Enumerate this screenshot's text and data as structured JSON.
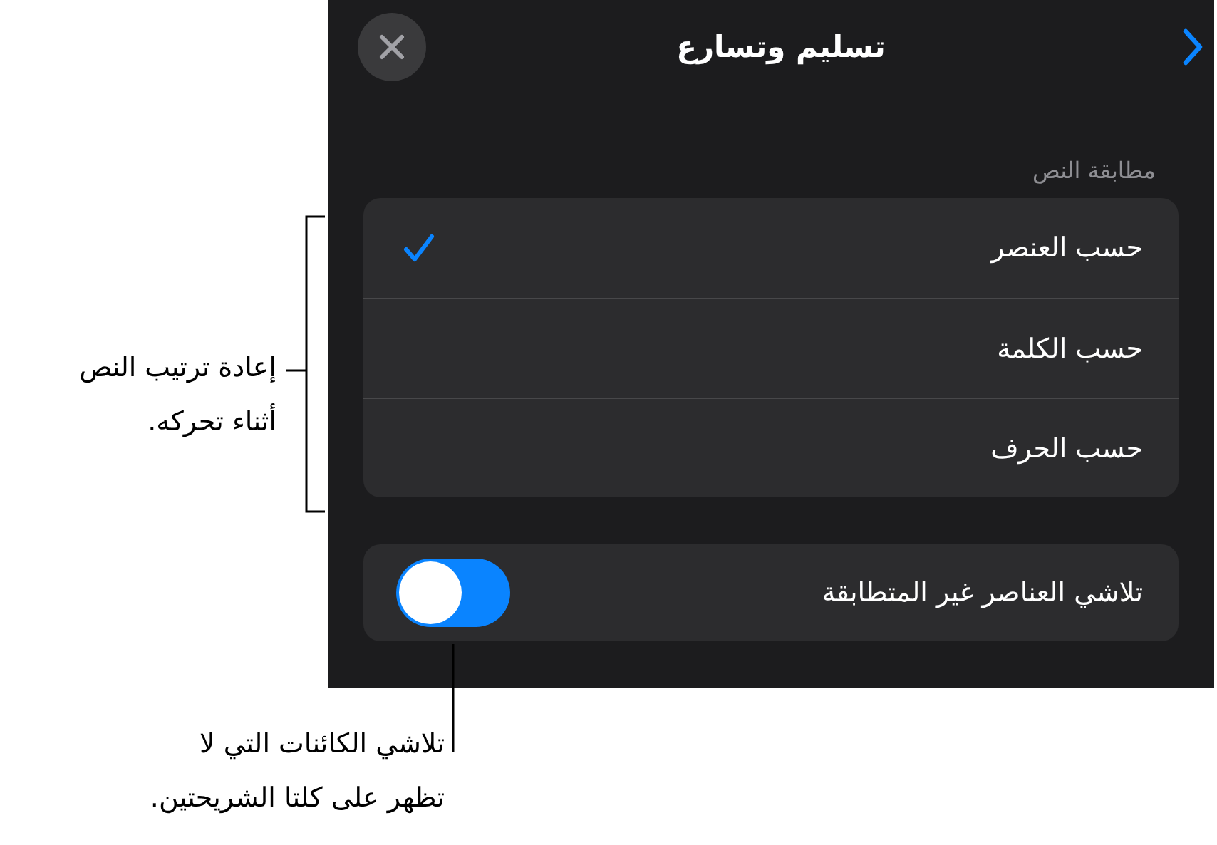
{
  "panel": {
    "title": "تسليم وتسارع"
  },
  "section_label": "مطابقة النص",
  "options": [
    {
      "label": "حسب العنصر",
      "selected": true
    },
    {
      "label": "حسب الكلمة",
      "selected": false
    },
    {
      "label": "حسب الحرف",
      "selected": false
    }
  ],
  "fade_toggle": {
    "label": "تلاشي العناصر غير المتطابقة",
    "on": true
  },
  "callouts": [
    {
      "lines": [
        "إعادة ترتيب النص",
        "أثناء تحركه."
      ]
    },
    {
      "lines": [
        "تلاشي الكائنات التي لا",
        "تظهر على كلتا الشريحتين."
      ]
    }
  ]
}
